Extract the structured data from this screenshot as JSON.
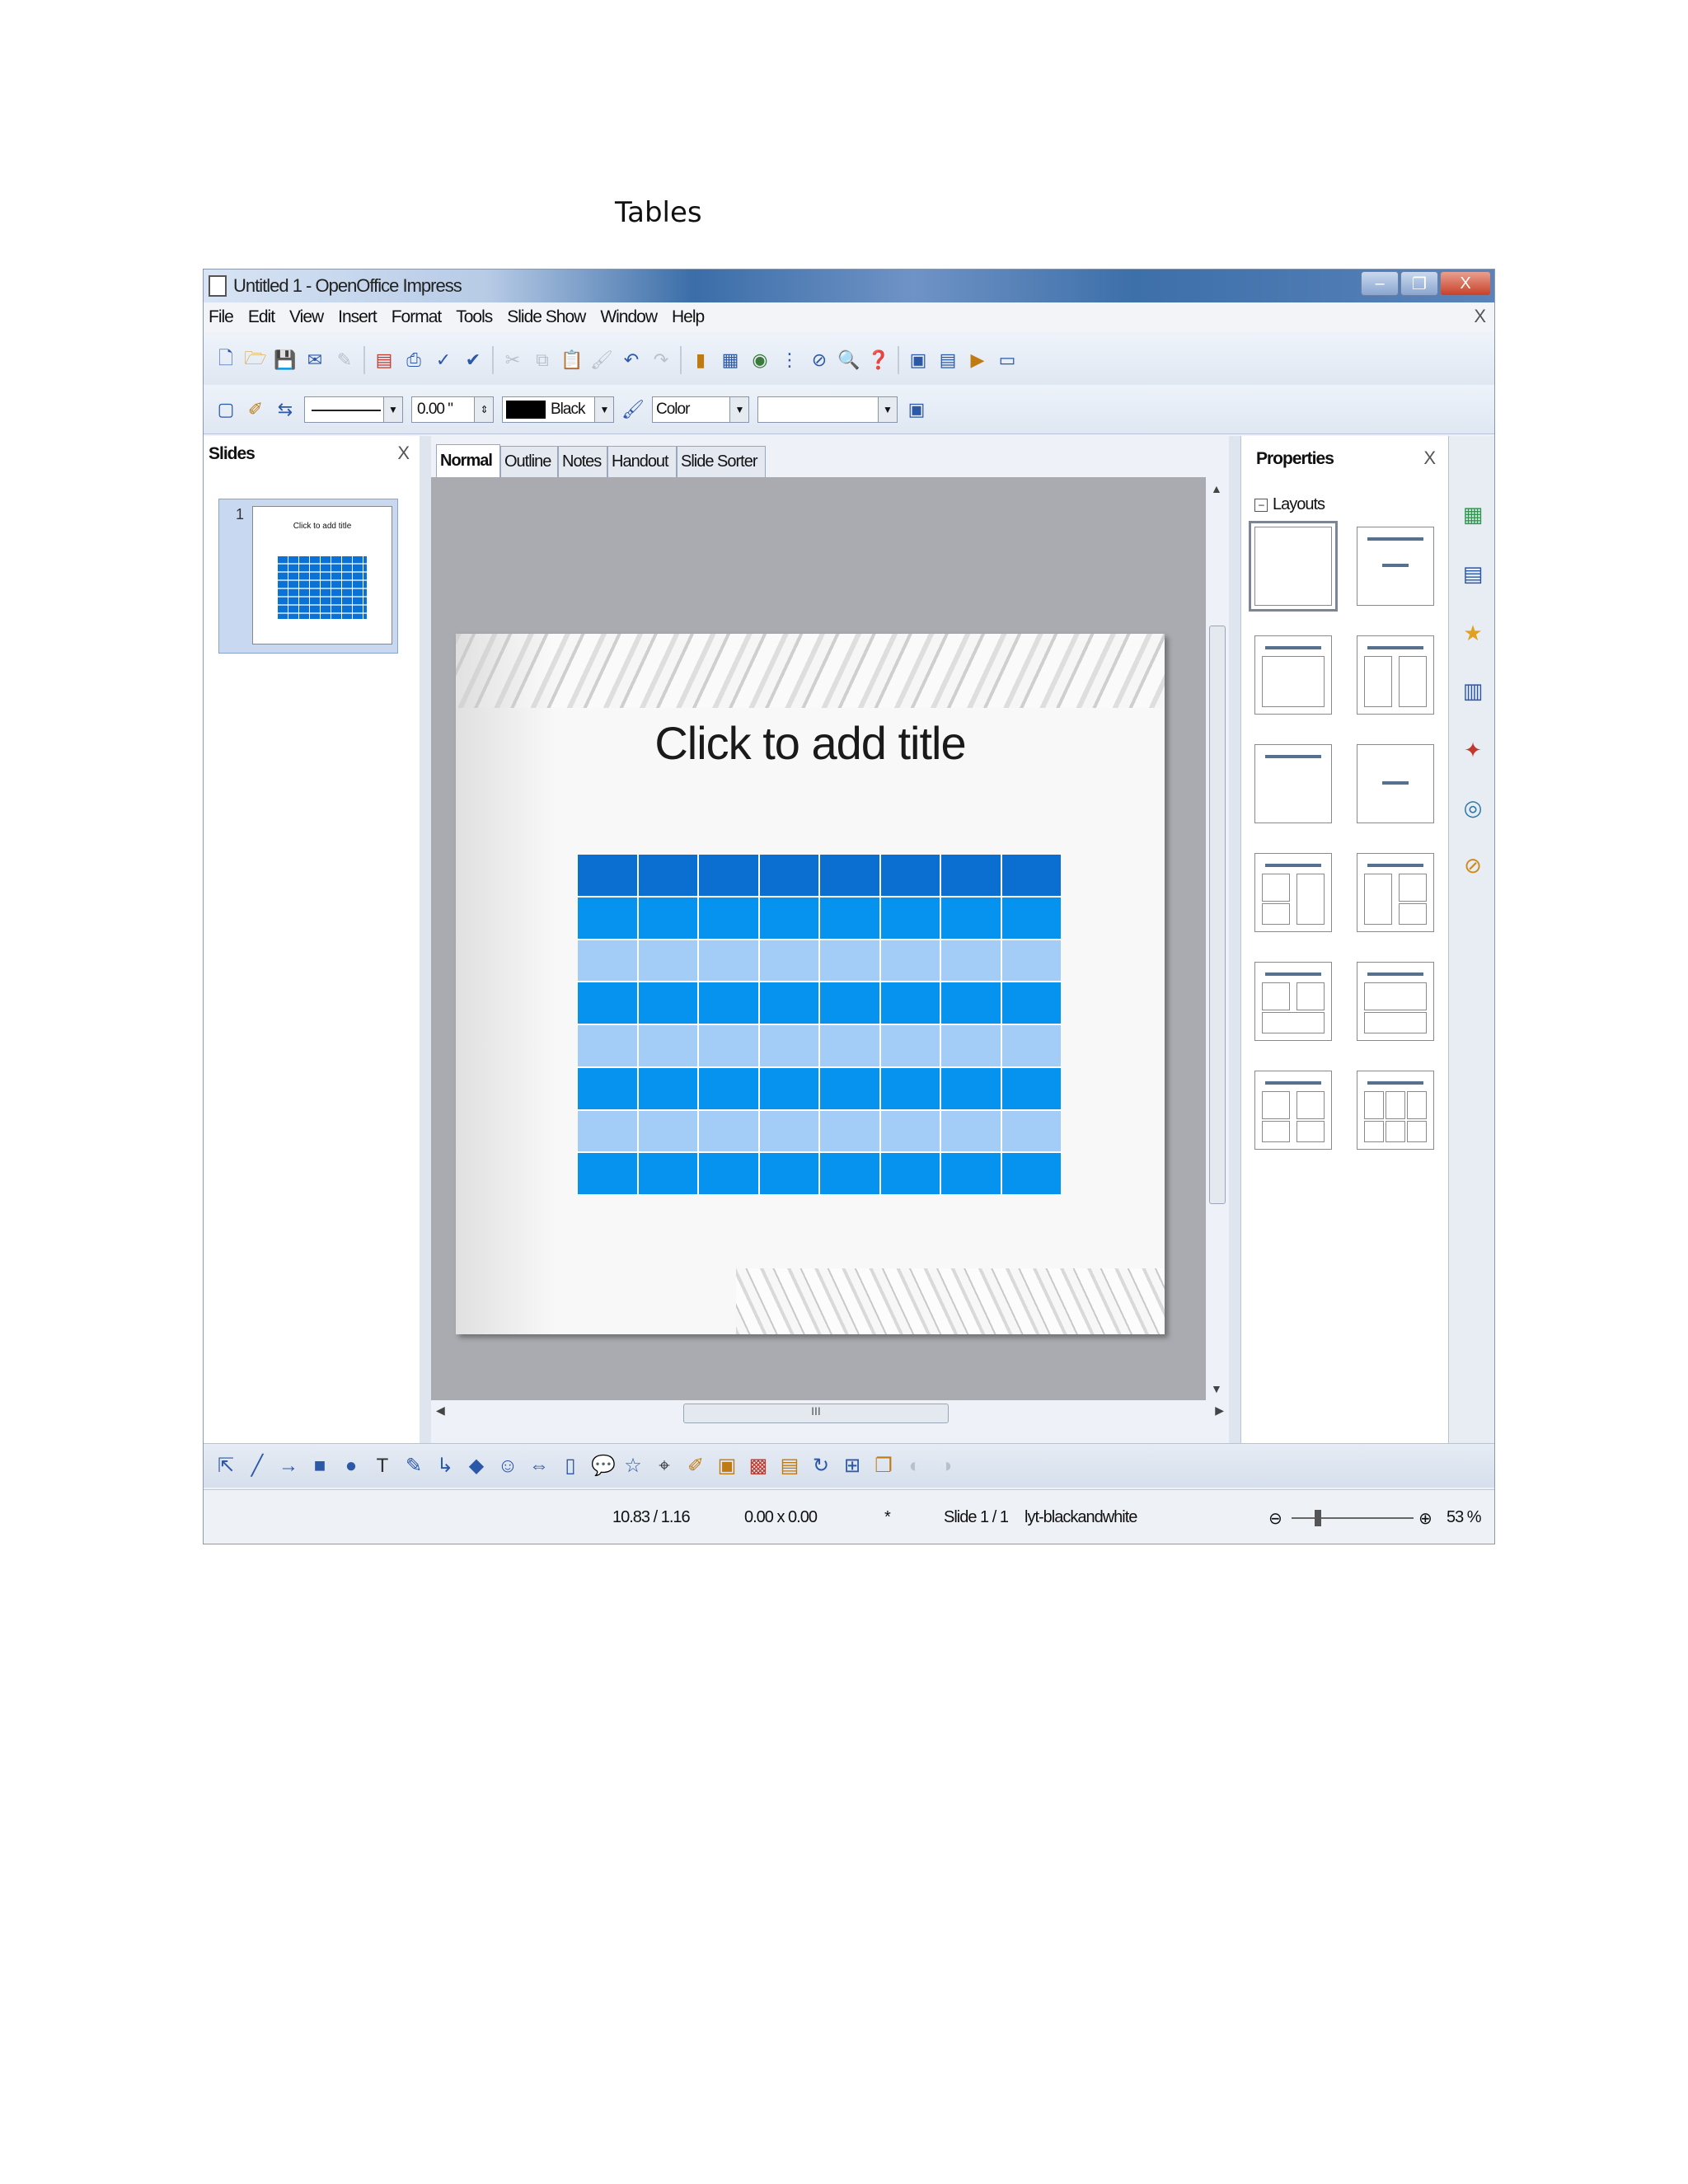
{
  "page": {
    "caption": "Tables"
  },
  "window": {
    "title": "Untitled 1 - OpenOffice Impress",
    "controls": {
      "minimize": "–",
      "restore": "❐",
      "close": "X"
    },
    "doc_close": "X"
  },
  "menu": [
    "File",
    "Edit",
    "View",
    "Insert",
    "Format",
    "Tools",
    "Slide Show",
    "Window",
    "Help"
  ],
  "format_toolbar": {
    "line_width": "0.00 \"",
    "line_color": "Black",
    "area_style": "Color",
    "colors": {
      "line_color_swatch": "#000000"
    }
  },
  "slides_pane": {
    "title": "Slides",
    "close": "X",
    "thumbnails": [
      {
        "number": "1",
        "title": "Click to add title"
      }
    ]
  },
  "view_tabs": [
    "Normal",
    "Outline",
    "Notes",
    "Handout",
    "Slide Sorter"
  ],
  "slide": {
    "title_placeholder": "Click to add title",
    "table": {
      "rows": 8,
      "columns": 8,
      "row_colors": [
        "#0a6fd0",
        "#0593ef",
        "#a3cdf6",
        "#0593ef",
        "#a3cdf6",
        "#0593ef",
        "#a3cdf6",
        "#0593ef"
      ]
    }
  },
  "properties_pane": {
    "title": "Properties",
    "close": "X",
    "section": "Layouts",
    "layouts": [
      "blank",
      "title-content-centered",
      "title-content",
      "title-two-content",
      "title-only",
      "centered-text",
      "title-content-two",
      "title-two-content-right",
      "title-two-over-content",
      "title-content-over-content",
      "title-four-content",
      "title-six-content"
    ]
  },
  "statusbar": {
    "position": "10.83 / 1.16",
    "size": "0.00 x 0.00",
    "modified": "*",
    "slide": "Slide 1 / 1",
    "master": "lyt-blackandwhite",
    "zoom": "53 %"
  },
  "scrollbar_grip": "III"
}
